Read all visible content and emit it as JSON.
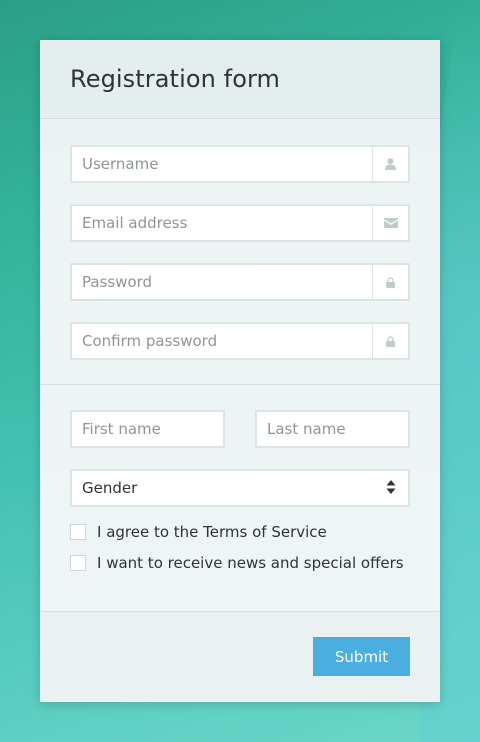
{
  "form": {
    "title": "Registration form",
    "fields": {
      "username": {
        "placeholder": "Username",
        "icon": "user-icon"
      },
      "email": {
        "placeholder": "Email address",
        "icon": "envelope-icon"
      },
      "password": {
        "placeholder": "Password",
        "icon": "lock-icon"
      },
      "confirm_password": {
        "placeholder": "Confirm password",
        "icon": "lock-icon"
      },
      "first_name": {
        "placeholder": "First name"
      },
      "last_name": {
        "placeholder": "Last name"
      }
    },
    "gender": {
      "selected": "Gender",
      "icon": "select-arrows-icon"
    },
    "checkboxes": {
      "terms": {
        "label": "I agree to the Terms of Service",
        "checked": false
      },
      "news": {
        "label": "I want to receive news and special offers",
        "checked": false
      }
    },
    "submit_label": "Submit"
  },
  "colors": {
    "accent": "#4aaee0",
    "background_gradient_start": "#2a9f86",
    "background_gradient_end": "#6ad6c8"
  }
}
